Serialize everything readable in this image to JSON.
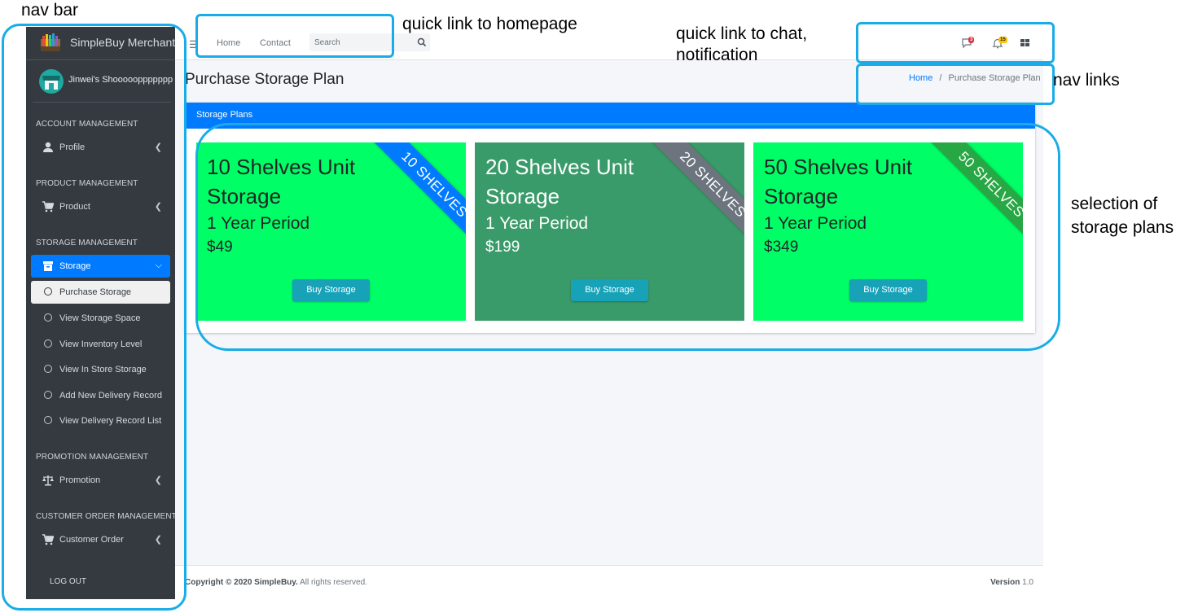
{
  "annotations": {
    "nav_bar": "nav bar",
    "homepage_link": "quick link to homepage",
    "chat_notification_line1": "quick link to chat,",
    "chat_notification_line2": "notification",
    "nav_links": "nav links",
    "storage_plans_line1": "selection of",
    "storage_plans_line2": "storage plans"
  },
  "sidebar": {
    "brand": "SimpleBuy Merchant",
    "user": "Jinwei's Shoooooppppppp",
    "sections": [
      {
        "header": "ACCOUNT MANAGEMENT",
        "item": "Profile",
        "icon": "user-icon"
      },
      {
        "header": "PRODUCT MANAGEMENT",
        "item": "Product",
        "icon": "cart-icon"
      },
      {
        "header": "STORAGE MANAGEMENT",
        "item": "Storage",
        "icon": "archive-icon"
      },
      {
        "header": "PROMOTION MANAGEMENT",
        "item": "Promotion",
        "icon": "balance-scale-icon"
      },
      {
        "header": "CUSTOMER ORDER MANAGEMENT",
        "item": "Customer Order",
        "icon": "cart-icon"
      }
    ],
    "storage_subitems": [
      "Purchase Storage",
      "View Storage Space",
      "View Inventory Level",
      "View In Store Storage",
      "Add New Delivery Record",
      "View Delivery Record List"
    ],
    "logout": "LOG OUT"
  },
  "topbar": {
    "home": "Home",
    "contact": "Contact",
    "search_placeholder": "Search",
    "messages_badge": "3",
    "notifications_badge": "15"
  },
  "page": {
    "title": "Purchase Storage Plan",
    "breadcrumb_home": "Home",
    "breadcrumb_sep": "/",
    "breadcrumb_current": "Purchase Storage Plan"
  },
  "card": {
    "title": "Storage Plans",
    "plans": [
      {
        "name": "10 Shelves Unit Storage",
        "period": "1 Year Period",
        "price": "$49",
        "ribbon": "10 SHELVES",
        "button": "Buy Storage",
        "bg": "#00ff66",
        "ribbon_color": "#007bff"
      },
      {
        "name": "20 Shelves Unit Storage",
        "period": "1 Year Period",
        "price": "$199",
        "ribbon": "20 SHELVES",
        "button": "Buy Storage",
        "bg": "#3a9b6a",
        "ribbon_color": "#6c757d"
      },
      {
        "name": "50 Shelves Unit Storage",
        "period": "1 Year Period",
        "price": "$349",
        "ribbon": "50 SHELVES",
        "button": "Buy Storage",
        "bg": "#00ff66",
        "ribbon_color": "#28a745"
      }
    ]
  },
  "footer": {
    "copyright_bold": "Copyright © 2020 SimpleBuy.",
    "copyright_rest": " All rights reserved.",
    "version_label": "Version",
    "version_value": " 1.0"
  }
}
